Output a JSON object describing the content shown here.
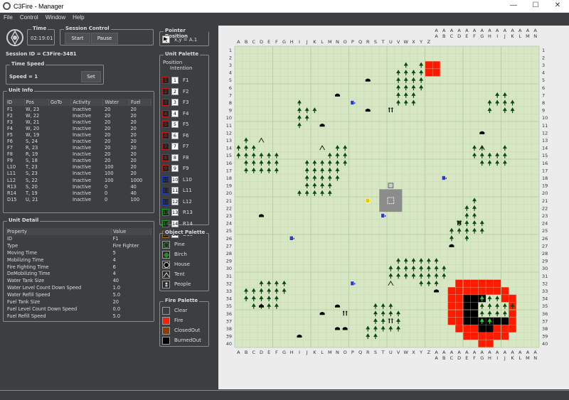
{
  "window": {
    "title": "C3Fire - Manager",
    "minimize": "—",
    "maximize": "☐",
    "close": "✕"
  },
  "menu": [
    "File",
    "Control",
    "Window",
    "Help"
  ],
  "time": {
    "title": "Time",
    "value": "02:19:01"
  },
  "session_control": {
    "title": "Session Control",
    "start": "Start",
    "pause": "Pause"
  },
  "session_id": "Session ID = C3Fire-3481",
  "time_speed": {
    "title": "Time Speed",
    "label": "Speed = 1",
    "set": "Set"
  },
  "unit_info": {
    "title": "Unit Info",
    "columns": [
      "ID",
      "Pos",
      "GoTo",
      "Activity",
      "Water",
      "Fuel"
    ],
    "rows": [
      [
        "F1",
        "W, 23",
        "",
        "Inactive",
        "20",
        "20"
      ],
      [
        "F2",
        "W, 22",
        "",
        "Inactive",
        "20",
        "20"
      ],
      [
        "F3",
        "W, 21",
        "",
        "Inactive",
        "20",
        "20"
      ],
      [
        "F4",
        "W, 20",
        "",
        "Inactive",
        "20",
        "20"
      ],
      [
        "F5",
        "W, 19",
        "",
        "Inactive",
        "20",
        "20"
      ],
      [
        "F6",
        "S, 24",
        "",
        "Inactive",
        "20",
        "20"
      ],
      [
        "F7",
        "R, 23",
        "",
        "Inactive",
        "20",
        "20"
      ],
      [
        "F8",
        "R, 19",
        "",
        "Inactive",
        "20",
        "20"
      ],
      [
        "F9",
        "S, 18",
        "",
        "Inactive",
        "20",
        "20"
      ],
      [
        "L10",
        "T, 23",
        "",
        "Inactive",
        "100",
        "20"
      ],
      [
        "L11",
        "S, 23",
        "",
        "Inactive",
        "100",
        "20"
      ],
      [
        "L12",
        "S, 22",
        "",
        "Inactive",
        "100",
        "1000"
      ],
      [
        "R13",
        "S, 20",
        "",
        "Inactive",
        "0",
        "40"
      ],
      [
        "R14",
        "T, 19",
        "",
        "Inactive",
        "0",
        "40"
      ],
      [
        "D15",
        "U, 21",
        "",
        "Inactive",
        "0",
        "100"
      ]
    ]
  },
  "unit_detail": {
    "title": "Unit Detail",
    "columns": [
      "Property",
      "Value"
    ],
    "rows": [
      [
        "ID",
        "F1"
      ],
      [
        "Type",
        "Fire Fighter"
      ],
      [
        "Moving Time",
        "5"
      ],
      [
        "Mobilizing Time",
        "4"
      ],
      [
        "Fire Fighting Time",
        "6"
      ],
      [
        "DeMobilizing Time",
        "4"
      ],
      [
        "Water Tank Size",
        "40"
      ],
      [
        "Water Level Count Down Speed",
        "1.0"
      ],
      [
        "Water Refill Speed",
        "5.0"
      ],
      [
        "Fuel Tank Size",
        "20"
      ],
      [
        "Fuel Level Count Down Speed",
        "0.0"
      ],
      [
        "Fuel Refill Speed",
        "5.0"
      ]
    ]
  },
  "pointer_position": {
    "title": "Pointer Position",
    "value": "x,y =  A.1"
  },
  "unit_palette": {
    "title": "Unit Palette",
    "col_position": "Position",
    "col_intention": "Intention",
    "items": [
      {
        "num": "1",
        "label": "F1",
        "color": "#c02020"
      },
      {
        "num": "2",
        "label": "F2",
        "color": "#c02020"
      },
      {
        "num": "3",
        "label": "F3",
        "color": "#c02020"
      },
      {
        "num": "4",
        "label": "F4",
        "color": "#c02020"
      },
      {
        "num": "5",
        "label": "F5",
        "color": "#c02020"
      },
      {
        "num": "6",
        "label": "F6",
        "color": "#c02020"
      },
      {
        "num": "7",
        "label": "F7",
        "color": "#c02020"
      },
      {
        "num": "8",
        "label": "F8",
        "color": "#c02020"
      },
      {
        "num": "9",
        "label": "F9",
        "color": "#c02020"
      },
      {
        "num": "10",
        "label": "L10",
        "color": "#2040c0"
      },
      {
        "num": "11",
        "label": "L11",
        "color": "#2040c0"
      },
      {
        "num": "12",
        "label": "L12",
        "color": "#2040c0"
      },
      {
        "num": "13",
        "label": "R13",
        "color": "#20a020"
      },
      {
        "num": "14",
        "label": "R14",
        "color": "#20a020"
      },
      {
        "num": "15",
        "label": "D15",
        "color": "#a07020"
      }
    ]
  },
  "object_palette": {
    "title": "Object Palette",
    "items": [
      {
        "label": "Pine",
        "icon": "pine-icon"
      },
      {
        "label": "Birch",
        "icon": "birch-icon"
      },
      {
        "label": "House",
        "icon": "house-icon"
      },
      {
        "label": "Tent",
        "icon": "tent-icon"
      },
      {
        "label": "People",
        "icon": "people-icon"
      }
    ]
  },
  "fire_palette": {
    "title": "Fire Palette",
    "items": [
      {
        "label": "Clear",
        "color": "#3c3f41"
      },
      {
        "label": "Fire",
        "color": "#ff2000"
      },
      {
        "label": "ClosedOut",
        "color": "#8b3c00"
      },
      {
        "label": "BurnedOut",
        "color": "#000000"
      }
    ]
  },
  "map": {
    "columns": [
      "A",
      "B",
      "C",
      "D",
      "E",
      "F",
      "G",
      "H",
      "I",
      "J",
      "K",
      "L",
      "M",
      "N",
      "O",
      "P",
      "Q",
      "R",
      "S",
      "T",
      "U",
      "V",
      "W",
      "X",
      "Y",
      "Z",
      "AA",
      "AB",
      "AC",
      "AD",
      "AE",
      "AF",
      "AG",
      "AH",
      "AI",
      "AJ",
      "AK",
      "AL",
      "AM",
      "AN"
    ],
    "rows": [
      "1",
      "2",
      "3",
      "4",
      "5",
      "6",
      "7",
      "8",
      "9",
      "10",
      "11",
      "12",
      "13",
      "14",
      "15",
      "16",
      "17",
      "18",
      "19",
      "20",
      "21",
      "22",
      "23",
      "24",
      "25",
      "26",
      "27",
      "28",
      "29",
      "30",
      "31",
      "32",
      "33",
      "34",
      "35",
      "36",
      "37",
      "38",
      "39",
      "40"
    ],
    "colors": {
      "ground": "#d7e7c4",
      "grid": "#b4c8a0",
      "fire": "#ff1a00",
      "burned": "#000000",
      "tree": "#0b4a12",
      "depot": "#8c8c8c"
    },
    "trees": [
      [
        23,
        3
      ],
      [
        25,
        3
      ],
      [
        22,
        4
      ],
      [
        23,
        4
      ],
      [
        24,
        4
      ],
      [
        25,
        4
      ],
      [
        22,
        5
      ],
      [
        23,
        5
      ],
      [
        24,
        5
      ],
      [
        25,
        5
      ],
      [
        22,
        6
      ],
      [
        23,
        6
      ],
      [
        24,
        6
      ],
      [
        25,
        6
      ],
      [
        22,
        7
      ],
      [
        23,
        7
      ],
      [
        24,
        7
      ],
      [
        22,
        8
      ],
      [
        23,
        8
      ],
      [
        24,
        8
      ],
      [
        9,
        8
      ],
      [
        9,
        9
      ],
      [
        10,
        9
      ],
      [
        11,
        9
      ],
      [
        9,
        10
      ],
      [
        10,
        10
      ],
      [
        9,
        11
      ],
      [
        35,
        7
      ],
      [
        36,
        7
      ],
      [
        34,
        8
      ],
      [
        35,
        8
      ],
      [
        36,
        8
      ],
      [
        37,
        8
      ],
      [
        34,
        9
      ],
      [
        36,
        9
      ],
      [
        37,
        9
      ],
      [
        2,
        13
      ],
      [
        1,
        14
      ],
      [
        2,
        14
      ],
      [
        3,
        14
      ],
      [
        1,
        15
      ],
      [
        2,
        15
      ],
      [
        3,
        15
      ],
      [
        4,
        15
      ],
      [
        5,
        15
      ],
      [
        6,
        15
      ],
      [
        2,
        16
      ],
      [
        3,
        16
      ],
      [
        4,
        16
      ],
      [
        5,
        16
      ],
      [
        6,
        16
      ],
      [
        2,
        17
      ],
      [
        3,
        17
      ],
      [
        4,
        17
      ],
      [
        5,
        17
      ],
      [
        6,
        17
      ],
      [
        14,
        14
      ],
      [
        15,
        14
      ],
      [
        13,
        15
      ],
      [
        14,
        15
      ],
      [
        15,
        15
      ],
      [
        10,
        16
      ],
      [
        11,
        16
      ],
      [
        12,
        16
      ],
      [
        13,
        16
      ],
      [
        14,
        16
      ],
      [
        15,
        16
      ],
      [
        10,
        17
      ],
      [
        11,
        17
      ],
      [
        12,
        17
      ],
      [
        13,
        17
      ],
      [
        14,
        17
      ],
      [
        10,
        18
      ],
      [
        11,
        18
      ],
      [
        12,
        18
      ],
      [
        13,
        18
      ],
      [
        14,
        18
      ],
      [
        10,
        19
      ],
      [
        11,
        19
      ],
      [
        12,
        19
      ],
      [
        13,
        19
      ],
      [
        9,
        20
      ],
      [
        10,
        20
      ],
      [
        11,
        20
      ],
      [
        12,
        20
      ],
      [
        13,
        20
      ],
      [
        32,
        14
      ],
      [
        33,
        14
      ],
      [
        36,
        14
      ],
      [
        32,
        15
      ],
      [
        33,
        15
      ],
      [
        34,
        15
      ],
      [
        35,
        15
      ],
      [
        36,
        15
      ],
      [
        33,
        16
      ],
      [
        34,
        16
      ],
      [
        35,
        16
      ],
      [
        36,
        16
      ],
      [
        32,
        21
      ],
      [
        31,
        22
      ],
      [
        32,
        22
      ],
      [
        31,
        23
      ],
      [
        32,
        23
      ],
      [
        30,
        24
      ],
      [
        31,
        24
      ],
      [
        32,
        24
      ],
      [
        33,
        24
      ],
      [
        29,
        25
      ],
      [
        30,
        25
      ],
      [
        31,
        25
      ],
      [
        32,
        25
      ],
      [
        33,
        25
      ],
      [
        29,
        26
      ],
      [
        31,
        26
      ],
      [
        22,
        29
      ],
      [
        23,
        29
      ],
      [
        24,
        29
      ],
      [
        25,
        29
      ],
      [
        26,
        29
      ],
      [
        27,
        29
      ],
      [
        21,
        30
      ],
      [
        22,
        30
      ],
      [
        23,
        30
      ],
      [
        24,
        30
      ],
      [
        25,
        30
      ],
      [
        26,
        30
      ],
      [
        27,
        30
      ],
      [
        28,
        30
      ],
      [
        21,
        31
      ],
      [
        22,
        31
      ],
      [
        23,
        31
      ],
      [
        24,
        31
      ],
      [
        25,
        31
      ],
      [
        26,
        31
      ],
      [
        27,
        31
      ],
      [
        28,
        31
      ],
      [
        25,
        32
      ],
      [
        26,
        32
      ],
      [
        27,
        32
      ],
      [
        4,
        32
      ],
      [
        5,
        32
      ],
      [
        6,
        32
      ],
      [
        7,
        32
      ],
      [
        2,
        33
      ],
      [
        3,
        33
      ],
      [
        4,
        33
      ],
      [
        5,
        33
      ],
      [
        6,
        33
      ],
      [
        7,
        33
      ],
      [
        2,
        34
      ],
      [
        3,
        34
      ],
      [
        4,
        34
      ],
      [
        5,
        34
      ],
      [
        6,
        34
      ],
      [
        3,
        35
      ],
      [
        4,
        35
      ],
      [
        5,
        35
      ],
      [
        6,
        35
      ],
      [
        19,
        35
      ],
      [
        20,
        35
      ],
      [
        21,
        35
      ],
      [
        19,
        36
      ],
      [
        20,
        36
      ],
      [
        21,
        36
      ],
      [
        22,
        36
      ],
      [
        19,
        37
      ],
      [
        20,
        37
      ],
      [
        22,
        37
      ],
      [
        18,
        38
      ],
      [
        19,
        38
      ],
      [
        20,
        38
      ],
      [
        21,
        38
      ],
      [
        22,
        38
      ],
      [
        18,
        39
      ],
      [
        19,
        39
      ],
      [
        33,
        34
      ],
      [
        34,
        34
      ],
      [
        35,
        34
      ],
      [
        33,
        35
      ],
      [
        34,
        35
      ],
      [
        35,
        35
      ],
      [
        36,
        35
      ],
      [
        37,
        35
      ],
      [
        33,
        36
      ],
      [
        34,
        36
      ],
      [
        35,
        36
      ],
      [
        36,
        36
      ],
      [
        33,
        37
      ],
      [
        34,
        37
      ]
    ],
    "houses": [
      [
        18,
        5
      ],
      [
        14,
        7
      ],
      [
        18,
        9
      ],
      [
        12,
        11
      ],
      [
        33,
        12
      ],
      [
        4,
        23
      ],
      [
        29,
        27
      ],
      [
        27,
        33
      ],
      [
        4,
        35
      ],
      [
        14,
        35
      ],
      [
        15,
        38
      ],
      [
        9,
        39
      ],
      [
        14,
        38
      ],
      [
        12,
        36
      ]
    ],
    "people": [
      [
        21,
        9
      ],
      [
        30,
        24
      ],
      [
        15,
        36
      ],
      [
        21,
        37
      ]
    ],
    "tents": [
      [
        4,
        13
      ],
      [
        12,
        14
      ],
      [
        33,
        14
      ],
      [
        21,
        32
      ]
    ],
    "fire_cells": [
      [
        26,
        3
      ],
      [
        27,
        3
      ],
      [
        26,
        4
      ],
      [
        27,
        4
      ],
      [
        30,
        32
      ],
      [
        31,
        32
      ],
      [
        32,
        32
      ],
      [
        33,
        32
      ],
      [
        34,
        32
      ],
      [
        35,
        32
      ],
      [
        29,
        33
      ],
      [
        30,
        33
      ],
      [
        31,
        33
      ],
      [
        32,
        33
      ],
      [
        33,
        33
      ],
      [
        34,
        33
      ],
      [
        35,
        33
      ],
      [
        36,
        33
      ],
      [
        29,
        34
      ],
      [
        30,
        34
      ],
      [
        36,
        34
      ],
      [
        37,
        34
      ],
      [
        29,
        35
      ],
      [
        30,
        35
      ],
      [
        37,
        35
      ],
      [
        29,
        36
      ],
      [
        30,
        36
      ],
      [
        37,
        36
      ],
      [
        29,
        37
      ],
      [
        30,
        37
      ],
      [
        37,
        37
      ],
      [
        30,
        38
      ],
      [
        31,
        38
      ],
      [
        32,
        38
      ],
      [
        35,
        38
      ],
      [
        36,
        38
      ],
      [
        37,
        38
      ],
      [
        31,
        39
      ],
      [
        32,
        39
      ],
      [
        33,
        39
      ],
      [
        34,
        39
      ],
      [
        35,
        39
      ],
      [
        36,
        39
      ],
      [
        33,
        40
      ],
      [
        34,
        40
      ]
    ],
    "burned_cells": [
      [
        31,
        34
      ],
      [
        32,
        34
      ],
      [
        33,
        34
      ],
      [
        31,
        35
      ],
      [
        32,
        35
      ],
      [
        31,
        36
      ],
      [
        32,
        36
      ],
      [
        31,
        37
      ],
      [
        32,
        37
      ],
      [
        33,
        37
      ],
      [
        34,
        37
      ],
      [
        35,
        37
      ],
      [
        36,
        37
      ],
      [
        33,
        38
      ],
      [
        34,
        38
      ]
    ],
    "depot": {
      "col": 20,
      "row": 20,
      "w": 3,
      "h": 3
    },
    "units": [
      {
        "col": 16,
        "row": 8,
        "color": "#2840c8"
      },
      {
        "col": 28,
        "row": 18,
        "color": "#2840c8"
      },
      {
        "col": 20,
        "row": 23,
        "color": "#2840c8"
      },
      {
        "col": 8,
        "row": 26,
        "color": "#2840c8"
      },
      {
        "col": 16,
        "row": 32,
        "color": "#2840c8"
      },
      {
        "col": 18,
        "row": 21,
        "color": "#e8c800"
      }
    ]
  }
}
